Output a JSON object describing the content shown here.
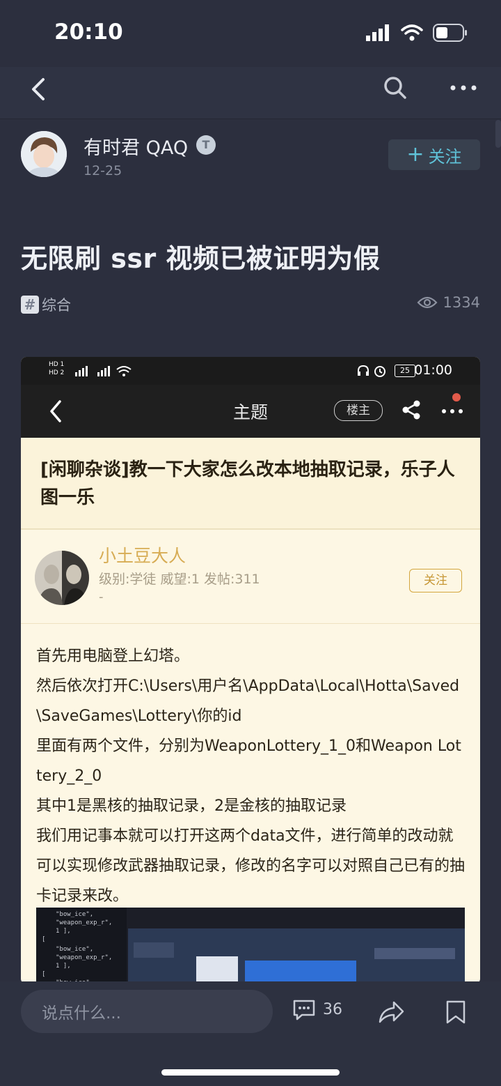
{
  "status": {
    "time": "20:10"
  },
  "nav": {},
  "author": {
    "name": "有时君 QAQ",
    "badge": "T",
    "date": "12-25",
    "follow_label": "关注"
  },
  "post": {
    "title": "无限刷 ssr 视频已被证明为假",
    "tag": "综合",
    "views": "1334"
  },
  "embed": {
    "status": {
      "time": "01:00",
      "battery": "25",
      "hd1": "HD 1",
      "hd2": "HD 2"
    },
    "nav": {
      "title": "主题",
      "op_label": "楼主"
    },
    "thread_title": "[闲聊杂谈]教一下大家怎么改本地抽取记录，乐子人图一乐",
    "user": {
      "name": "小土豆大人",
      "meta": "级别:学徒 威望:1 发帖:311",
      "dash": "-",
      "follow_label": "关注"
    },
    "body": [
      "首先用电脑登上幻塔。",
      "然后依次打开C:\\Users\\用户名\\AppData\\Local\\Hotta\\Saved\\SaveGames\\Lottery\\你的id",
      "里面有两个文件，分别为WeaponLottery_1_0和Weapon Lottery_2_0",
      "其中1是黑核的抽取记录，2是金核的抽取记录",
      "我们用记事本就可以打开这两个data文件，进行简单的改动就可以实现修改武器抽取记录，修改的名字可以对照自己已有的抽卡记录来改。"
    ]
  },
  "bottom": {
    "comment_placeholder": "说点什么...",
    "comment_count": "36"
  },
  "colors": {
    "background": "#2c2f3e",
    "accent": "#5fc2d8",
    "embed_bg": "#fdf7e4",
    "embed_username": "#d7ac54"
  }
}
